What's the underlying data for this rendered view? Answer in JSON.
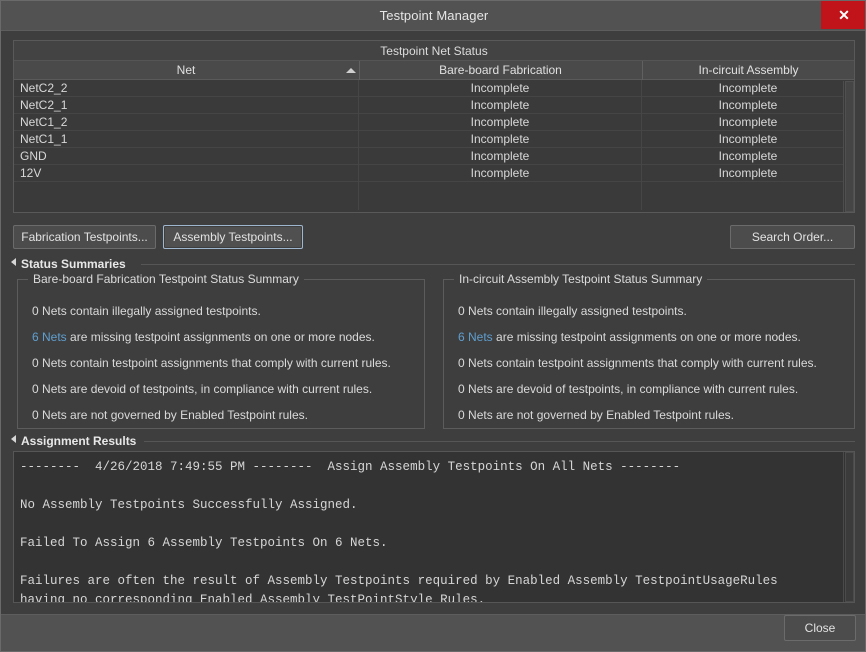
{
  "window": {
    "title": "Testpoint Manager",
    "close_icon": "close-x-icon",
    "close_glyph": "✕"
  },
  "grid": {
    "caption": "Testpoint Net Status",
    "columns": [
      "Net",
      "Bare-board Fabrication",
      "In-circuit Assembly"
    ],
    "sort_icon": "sort-ascending-icon",
    "rows": [
      {
        "net": "12V",
        "fabrication": "Incomplete",
        "assembly": "Incomplete"
      },
      {
        "net": "GND",
        "fabrication": "Incomplete",
        "assembly": "Incomplete"
      },
      {
        "net": "NetC1_1",
        "fabrication": "Incomplete",
        "assembly": "Incomplete"
      },
      {
        "net": "NetC1_2",
        "fabrication": "Incomplete",
        "assembly": "Incomplete"
      },
      {
        "net": "NetC2_1",
        "fabrication": "Incomplete",
        "assembly": "Incomplete"
      },
      {
        "net": "NetC2_2",
        "fabrication": "Incomplete",
        "assembly": "Incomplete"
      }
    ]
  },
  "toolbar": {
    "fabrication_testpoints": "Fabrication Testpoints...",
    "assembly_testpoints": "Assembly Testpoints...",
    "search_order": "Search Order..."
  },
  "status_summaries": {
    "header": "Status Summaries",
    "collapse_icon": "collapse-triangle-icon",
    "fabrication": {
      "title": "Bare-board Fabrication Testpoint Status Summary",
      "lines": [
        {
          "count": "0",
          "link": false,
          "text": " Nets contain illegally assigned testpoints."
        },
        {
          "count": "6 Nets",
          "link": true,
          "text": " are missing testpoint assignments on one or more nodes."
        },
        {
          "count": "0",
          "link": false,
          "text": " Nets contain testpoint assignments that comply with current rules."
        },
        {
          "count": "0",
          "link": false,
          "text": " Nets are devoid of testpoints, in compliance with current rules."
        },
        {
          "count": "0",
          "link": false,
          "text": " Nets are not governed by Enabled Testpoint rules."
        }
      ]
    },
    "assembly": {
      "title": "In-circuit Assembly Testpoint Status Summary",
      "lines": [
        {
          "count": "0",
          "link": false,
          "text": " Nets contain illegally assigned testpoints."
        },
        {
          "count": "6 Nets",
          "link": true,
          "text": " are missing testpoint assignments on one or more nodes."
        },
        {
          "count": "0",
          "link": false,
          "text": " Nets contain testpoint assignments that comply with current rules."
        },
        {
          "count": "0",
          "link": false,
          "text": " Nets are devoid of testpoints, in compliance with current rules."
        },
        {
          "count": "0",
          "link": false,
          "text": " Nets are not governed by Enabled Testpoint rules."
        }
      ]
    }
  },
  "assignment_results": {
    "header": "Assignment Results",
    "collapse_icon": "collapse-triangle-icon",
    "log": "--------  4/26/2018 7:49:55 PM --------  Assign Assembly Testpoints On All Nets --------\n\nNo Assembly Testpoints Successfully Assigned.\n\nFailed To Assign 6 Assembly Testpoints On 6 Nets.\n\nFailures are often the result of Assembly Testpoints required by Enabled Assembly TestpointUsageRules\nhaving no corresponding Enabled Assembly TestPointStyle Rules."
  },
  "footer": {
    "close": "Close"
  },
  "colors": {
    "accent_link": "#5f9fd0",
    "close_button": "#c0131a",
    "dialog_bg": "#3e3e3e",
    "titlebar_bg": "#525252"
  }
}
